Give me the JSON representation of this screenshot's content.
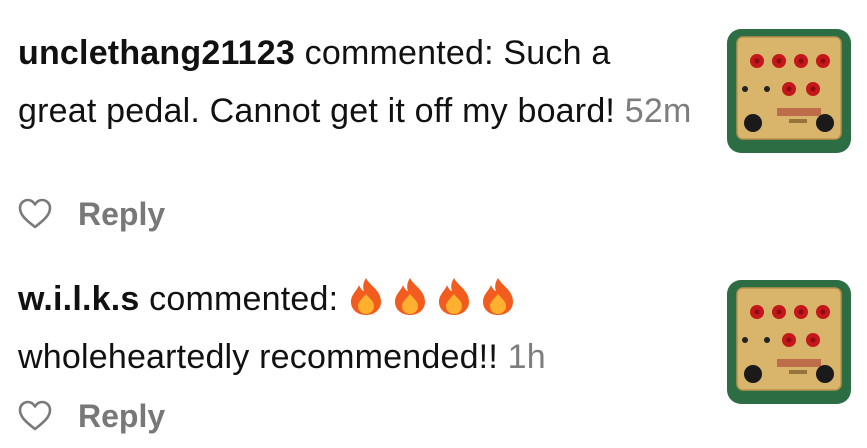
{
  "comments": [
    {
      "username": "unclethang21123",
      "action": " commented: ",
      "text": "Such a great pedal. Cannot get it off my board!",
      "time": "52m",
      "reply_label": "Reply",
      "like_icon": "heart-outline-icon",
      "thumbnail": "guitar-pedal-thumbnail"
    },
    {
      "username": "w.i.l.k.s",
      "action": " commented: ",
      "emojis": [
        "🔥",
        "🔥",
        "🔥",
        "🔥"
      ],
      "text": "wholeheartedly recommended!!",
      "time": "1h",
      "reply_label": "Reply",
      "like_icon": "heart-outline-icon",
      "thumbnail": "guitar-pedal-thumbnail"
    }
  ],
  "colors": {
    "text": "#111111",
    "muted": "#7d7d7d",
    "reply": "#787878",
    "thumb_bg": "#2d6d43",
    "pedal_body": "#d8b56a",
    "knob": "#c4171c"
  }
}
